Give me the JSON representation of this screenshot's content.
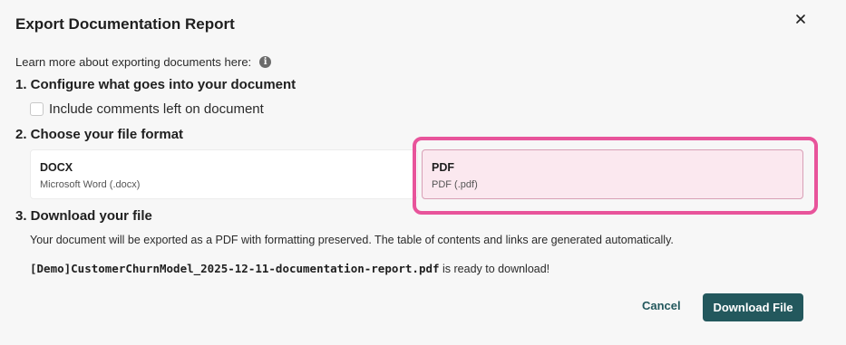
{
  "dialog": {
    "title": "Export Documentation Report",
    "close_icon": "close-icon"
  },
  "learn": {
    "text": "Learn more about exporting documents here:",
    "info_icon_glyph": "i"
  },
  "step1": {
    "heading": "1. Configure what goes into your document",
    "checkbox_label": "Include comments left on document",
    "checkbox_checked": false
  },
  "step2": {
    "heading": "2. Choose your file format",
    "formats": [
      {
        "title": "DOCX",
        "subtitle": "Microsoft Word (.docx)",
        "selected": false
      },
      {
        "title": "PDF",
        "subtitle": "PDF (.pdf)",
        "selected": true
      }
    ]
  },
  "step3": {
    "heading": "3. Download your file",
    "description": "Your document will be exported as a PDF with formatting preserved. The table of contents and links are generated automatically.",
    "filename": "[Demo]CustomerChurnModel_2025-12-11-documentation-report.pdf",
    "ready_suffix": " is ready to download!"
  },
  "actions": {
    "cancel_label": "Cancel",
    "download_label": "Download File"
  },
  "colors": {
    "accent": "#23585d",
    "highlight": "#e8549b",
    "selected_bg": "#fbe8ef"
  }
}
